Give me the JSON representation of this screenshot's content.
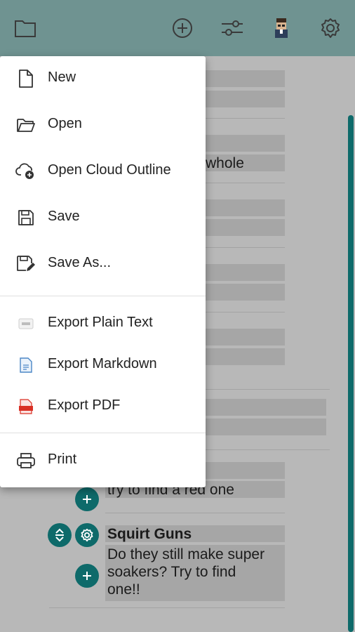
{
  "toolbar": {
    "icons": [
      "folder-icon",
      "add-circle-icon",
      "sliders-icon",
      "avatar",
      "gear-icon"
    ]
  },
  "background": {
    "fragment_whole": "whole",
    "fragment_red": "try to find a red one",
    "item_title": "Squirt Guns",
    "item_body": [
      "Do they still make super",
      "soakers?  Try to find",
      "one!!"
    ]
  },
  "menu": {
    "items": [
      {
        "label": "New",
        "icon": "file-icon"
      },
      {
        "label": "Open",
        "icon": "folder-open-icon"
      },
      {
        "label": "Open Cloud Outline",
        "icon": "cloud-add-icon"
      },
      {
        "label": "Save",
        "icon": "save-icon"
      },
      {
        "label": "Save As...",
        "icon": "save-as-icon"
      },
      {
        "label": "Export Plain Text",
        "icon": "txt-file-icon"
      },
      {
        "label": "Export Markdown",
        "icon": "markdown-file-icon"
      },
      {
        "label": "Export PDF",
        "icon": "pdf-file-icon"
      },
      {
        "label": "Print",
        "icon": "printer-icon"
      }
    ]
  },
  "colors": {
    "toolbar": "#6f9391",
    "accent": "#0e6a6a",
    "pdf_red": "#d93025",
    "markdown_blue": "#4a86c5"
  }
}
